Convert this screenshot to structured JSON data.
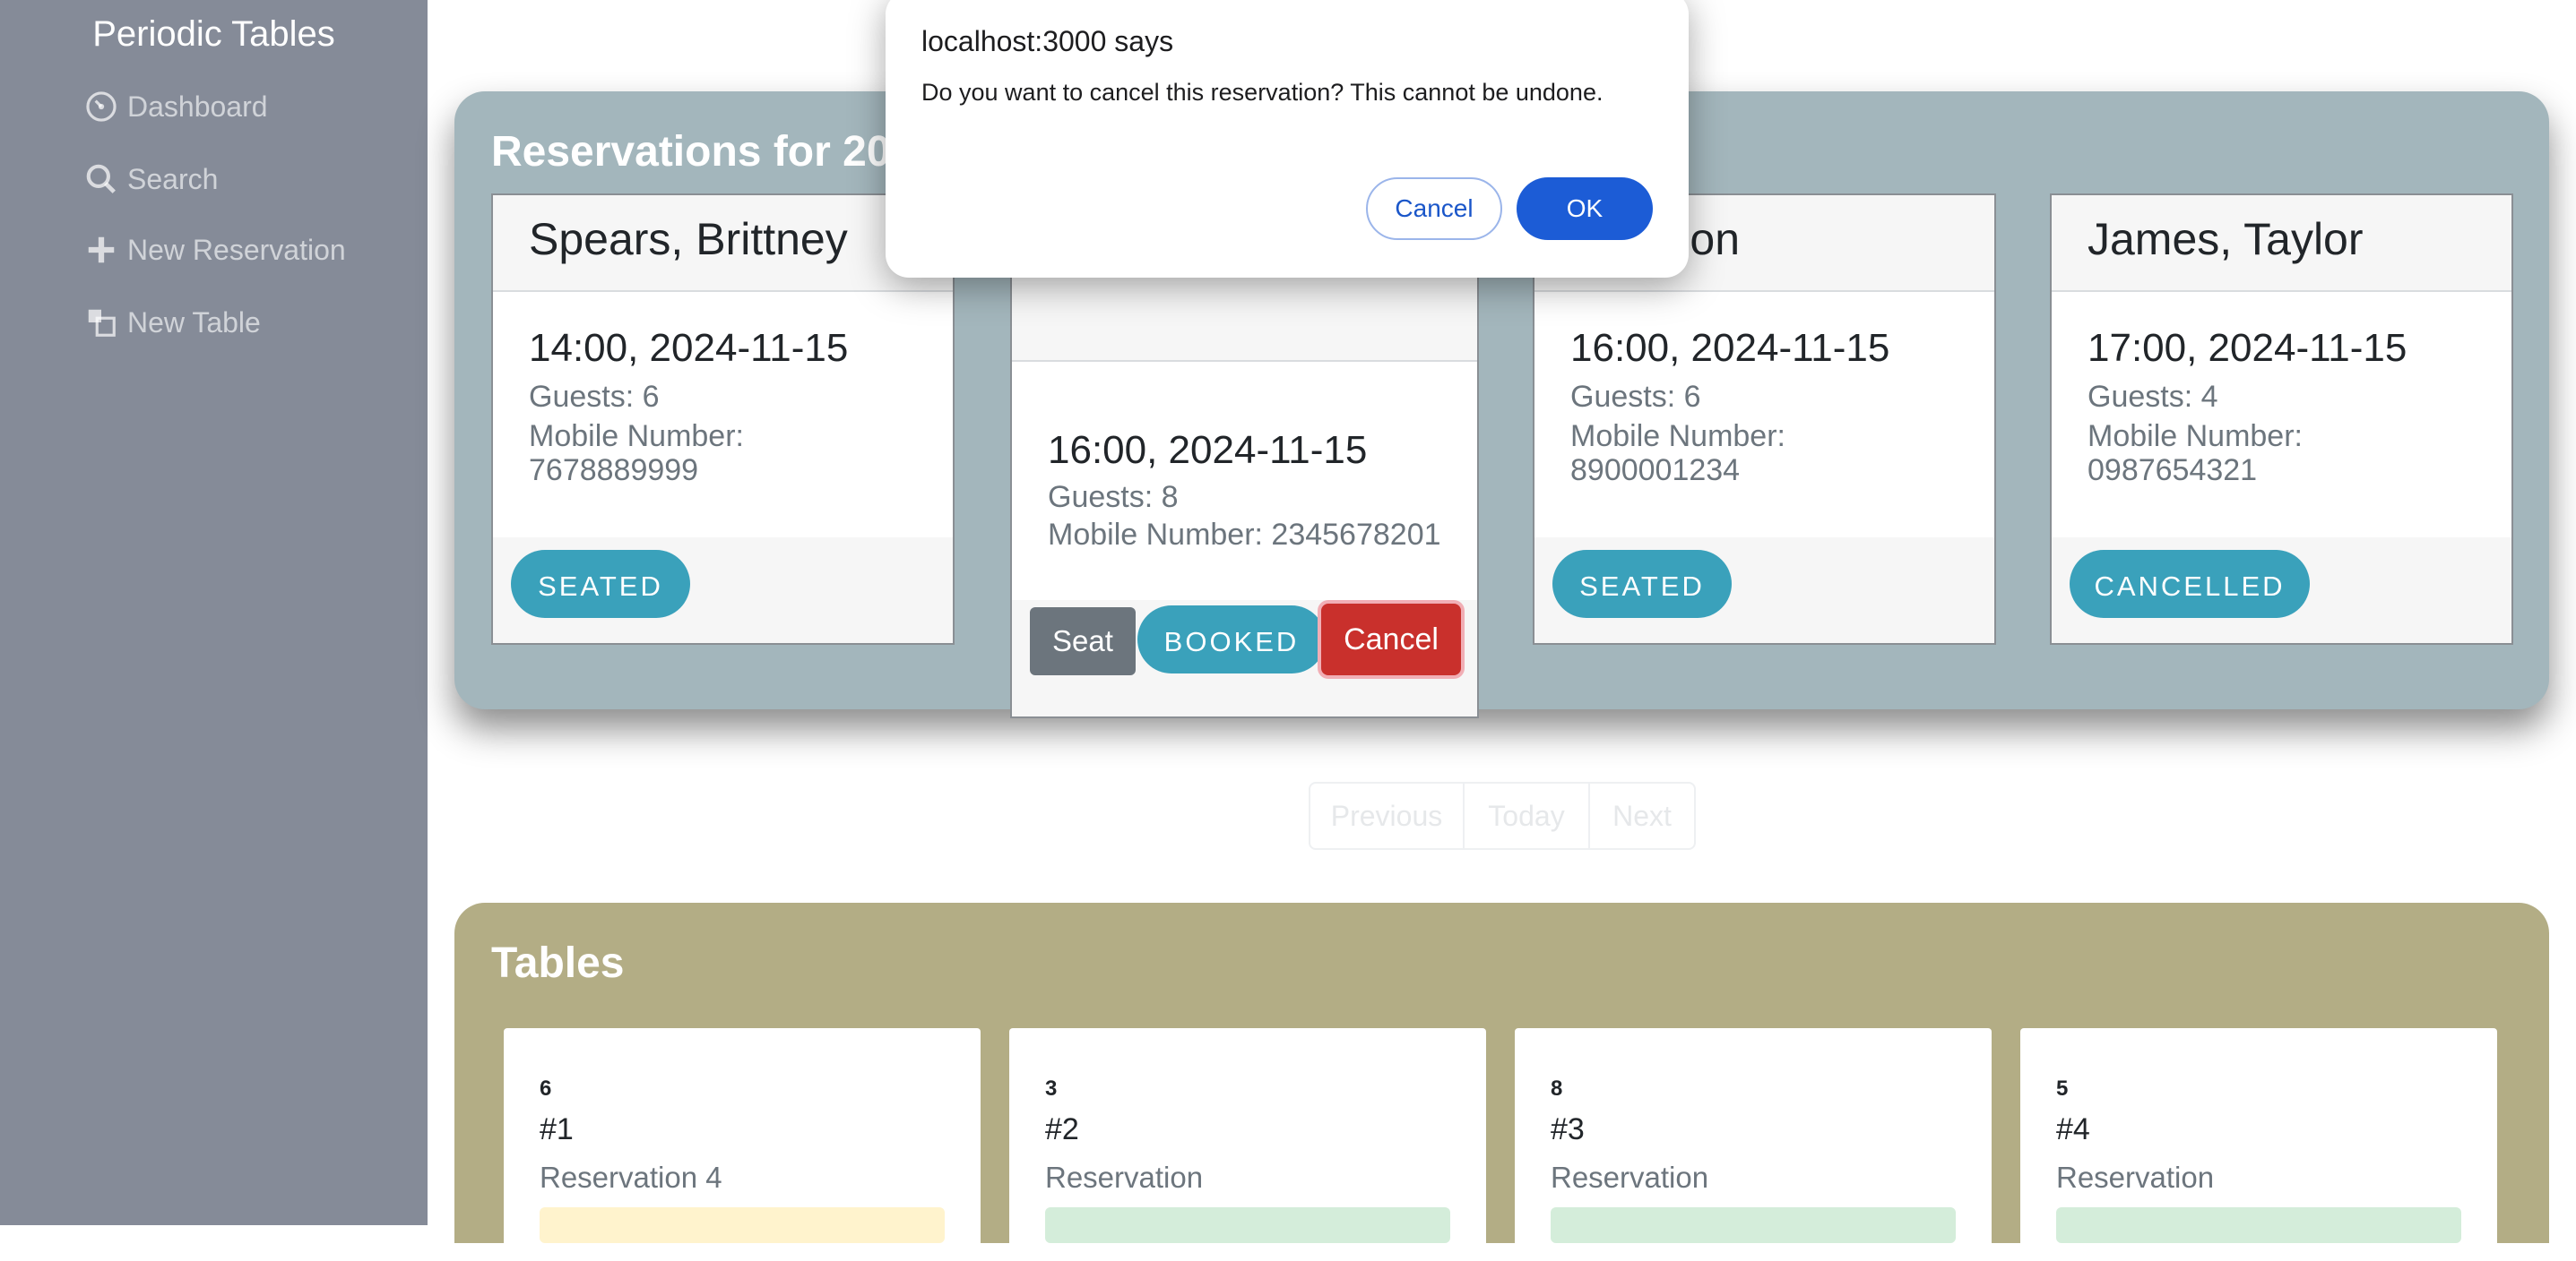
{
  "sidebar": {
    "brand": "Periodic Tables",
    "items": [
      {
        "label": "Dashboard",
        "icon": "dashboard-icon"
      },
      {
        "label": "Search",
        "icon": "search-icon"
      },
      {
        "label": "New Reservation",
        "icon": "plus-icon"
      },
      {
        "label": "New Table",
        "icon": "table-icon"
      }
    ]
  },
  "reservations": {
    "title_visible": "Reservations for 202",
    "cards": [
      {
        "name": "Spears, Brittney",
        "time": "14:00, 2024-11-15",
        "guests": "Guests: 6",
        "mobile_label": "Mobile Number:",
        "mobile": "7678889999",
        "status": "SEATED"
      },
      {
        "name": "",
        "time": "16:00, 2024-11-15",
        "guests": "Guests: 8",
        "mobile_label": "Mobile Number: 2345678201",
        "mobile": "",
        "status": "BOOKED",
        "seat_label": "Seat",
        "cancel_label": "Cancel"
      },
      {
        "name_visible": "a, Jason",
        "time": "16:00, 2024-11-15",
        "guests": "Guests: 6",
        "mobile_label": "Mobile Number:",
        "mobile": "8900001234",
        "status": "SEATED"
      },
      {
        "name": "James, Taylor",
        "time": "17:00, 2024-11-15",
        "guests": "Guests: 4",
        "mobile_label": "Mobile Number:",
        "mobile": "0987654321",
        "status": "CANCELLED"
      }
    ]
  },
  "pager": {
    "previous": "Previous",
    "today": "Today",
    "next": "Next"
  },
  "tables": {
    "title": "Tables",
    "items": [
      {
        "capacity": "6",
        "name": "#1",
        "reservation": "Reservation 4",
        "bar_color": "#fff3cd"
      },
      {
        "capacity": "3",
        "name": "#2",
        "reservation": "Reservation",
        "bar_color": "#d4edda"
      },
      {
        "capacity": "8",
        "name": "#3",
        "reservation": "Reservation",
        "bar_color": "#d4edda"
      },
      {
        "capacity": "5",
        "name": "#4",
        "reservation": "Reservation",
        "bar_color": "#d4edda"
      }
    ]
  },
  "dialog": {
    "title": "localhost:3000 says",
    "message": "Do you want to cancel this reservation? This cannot be undone.",
    "cancel": "Cancel",
    "ok": "OK"
  },
  "colors": {
    "sidebar": "#858b98",
    "reservations_panel": "#a3b6bc",
    "tables_panel": "#b3ad85",
    "status_pill": "#3aa1bb",
    "ok_button": "#1c5cd6",
    "cancel_button": "#c9302c"
  }
}
